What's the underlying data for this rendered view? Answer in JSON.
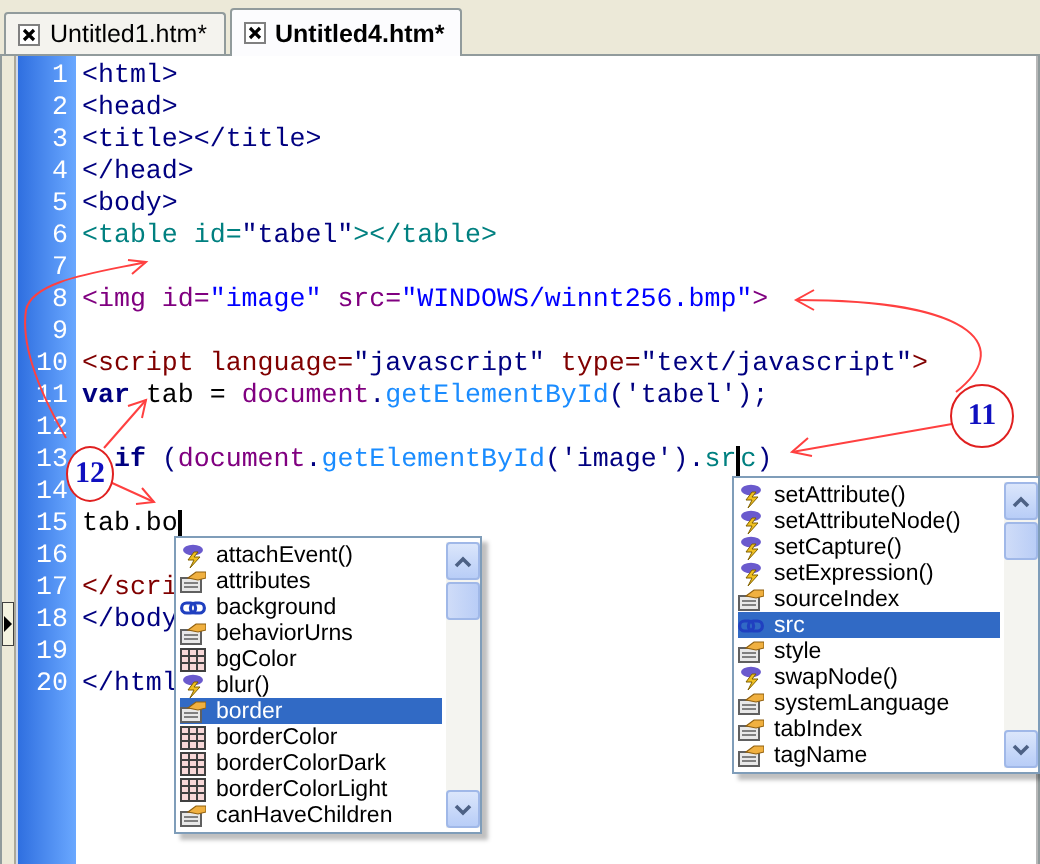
{
  "tabs": [
    {
      "label": "Untitled1.htm*",
      "selected": false
    },
    {
      "label": "Untitled4.htm*",
      "selected": true
    }
  ],
  "lines": [
    {
      "number": "1",
      "tokens": [
        {
          "text": "<html>",
          "kind": "tag"
        }
      ]
    },
    {
      "number": "2",
      "tokens": [
        {
          "text": "<head>",
          "kind": "tag"
        }
      ]
    },
    {
      "number": "3",
      "tokens": [
        {
          "text": "<title></title>",
          "kind": "tag"
        }
      ]
    },
    {
      "number": "4",
      "tokens": [
        {
          "text": "</head>",
          "kind": "tag"
        }
      ]
    },
    {
      "number": "5",
      "tokens": [
        {
          "text": "<body>",
          "kind": "tag"
        }
      ]
    },
    {
      "number": "6",
      "tokens": [
        {
          "text": "<table id=",
          "kind": "teal"
        },
        {
          "text": "\"tabel\"",
          "kind": "tag"
        },
        {
          "text": "></table>",
          "kind": "teal"
        }
      ]
    },
    {
      "number": "7"
    },
    {
      "number": "8",
      "tokens": [
        {
          "text": "<img id=",
          "kind": "purple"
        },
        {
          "text": "\"image\"",
          "kind": "value"
        },
        {
          "text": " src=",
          "kind": "purple"
        },
        {
          "text": "\"WINDOWS/winnt256.bmp\"",
          "kind": "value"
        },
        {
          "text": ">",
          "kind": "purple"
        }
      ]
    },
    {
      "number": "9"
    },
    {
      "number": "10",
      "tokens": [
        {
          "text": "<script language=",
          "kind": "script"
        },
        {
          "text": "\"javascript\"",
          "kind": "tag"
        },
        {
          "text": " type=",
          "kind": "script"
        },
        {
          "text": "\"text/javascript\"",
          "kind": "tag"
        },
        {
          "text": ">",
          "kind": "script"
        }
      ]
    },
    {
      "number": "11",
      "tokens": [
        {
          "text": "var",
          "kind": "keyword"
        },
        {
          "text": " tab = ",
          "kind": "plain"
        },
        {
          "text": "document",
          "kind": "purple"
        },
        {
          "text": ".",
          "kind": "tag"
        },
        {
          "text": "getElementById",
          "kind": "method"
        },
        {
          "text": "('tabel');",
          "kind": "tag"
        }
      ]
    },
    {
      "number": "12"
    },
    {
      "number": "13",
      "tokens": [
        {
          "text": "  if",
          "kind": "keyword"
        },
        {
          "text": " (",
          "kind": "tag"
        },
        {
          "text": "document",
          "kind": "purple"
        },
        {
          "text": ".",
          "kind": "tag"
        },
        {
          "text": "getElementById",
          "kind": "method"
        },
        {
          "text": "('image').",
          "kind": "tag"
        },
        {
          "text": "sr",
          "kind": "teal",
          "cursor_after": true
        },
        {
          "text": "c",
          "kind": "teal"
        },
        {
          "text": ")",
          "kind": "tag"
        }
      ]
    },
    {
      "number": "14"
    },
    {
      "number": "15",
      "tokens": [
        {
          "text": "tab.bo",
          "kind": "plain",
          "cursor_after": true
        }
      ]
    },
    {
      "number": "16"
    },
    {
      "number": "17",
      "tokens": [
        {
          "text": "</scri",
          "kind": "script"
        }
      ]
    },
    {
      "number": "18",
      "tokens": [
        {
          "text": "</body",
          "kind": "tag"
        }
      ]
    },
    {
      "number": "19"
    },
    {
      "number": "20",
      "tokens": [
        {
          "text": "</html",
          "kind": "tag"
        }
      ]
    }
  ],
  "completion_lists": [
    {
      "items": [
        {
          "label": "attachEvent()",
          "kind": "method",
          "selected": false
        },
        {
          "label": "attributes",
          "kind": "property",
          "selected": false
        },
        {
          "label": "background",
          "kind": "link",
          "selected": false
        },
        {
          "label": "behaviorUrns",
          "kind": "property",
          "selected": false
        },
        {
          "label": "bgColor",
          "kind": "grid",
          "selected": false
        },
        {
          "label": "blur()",
          "kind": "method",
          "selected": false
        },
        {
          "label": "border",
          "kind": "property",
          "selected": true
        },
        {
          "label": "borderColor",
          "kind": "grid",
          "selected": false
        },
        {
          "label": "borderColorDark",
          "kind": "grid",
          "selected": false
        },
        {
          "label": "borderColorLight",
          "kind": "grid",
          "selected": false
        },
        {
          "label": "canHaveChildren",
          "kind": "property",
          "selected": false
        }
      ]
    },
    {
      "items": [
        {
          "label": "setAttribute()",
          "kind": "method",
          "selected": false
        },
        {
          "label": "setAttributeNode()",
          "kind": "method",
          "selected": false
        },
        {
          "label": "setCapture()",
          "kind": "method",
          "selected": false
        },
        {
          "label": "setExpression()",
          "kind": "method",
          "selected": false
        },
        {
          "label": "sourceIndex",
          "kind": "property",
          "selected": false
        },
        {
          "label": "src",
          "kind": "link",
          "selected": true
        },
        {
          "label": "style",
          "kind": "property",
          "selected": false
        },
        {
          "label": "swapNode()",
          "kind": "method",
          "selected": false
        },
        {
          "label": "systemLanguage",
          "kind": "property",
          "selected": false
        },
        {
          "label": "tabIndex",
          "kind": "property",
          "selected": false
        },
        {
          "label": "tagName",
          "kind": "property",
          "selected": false
        }
      ]
    }
  ],
  "callouts": [
    {
      "label": "11"
    },
    {
      "label": "12"
    }
  ]
}
